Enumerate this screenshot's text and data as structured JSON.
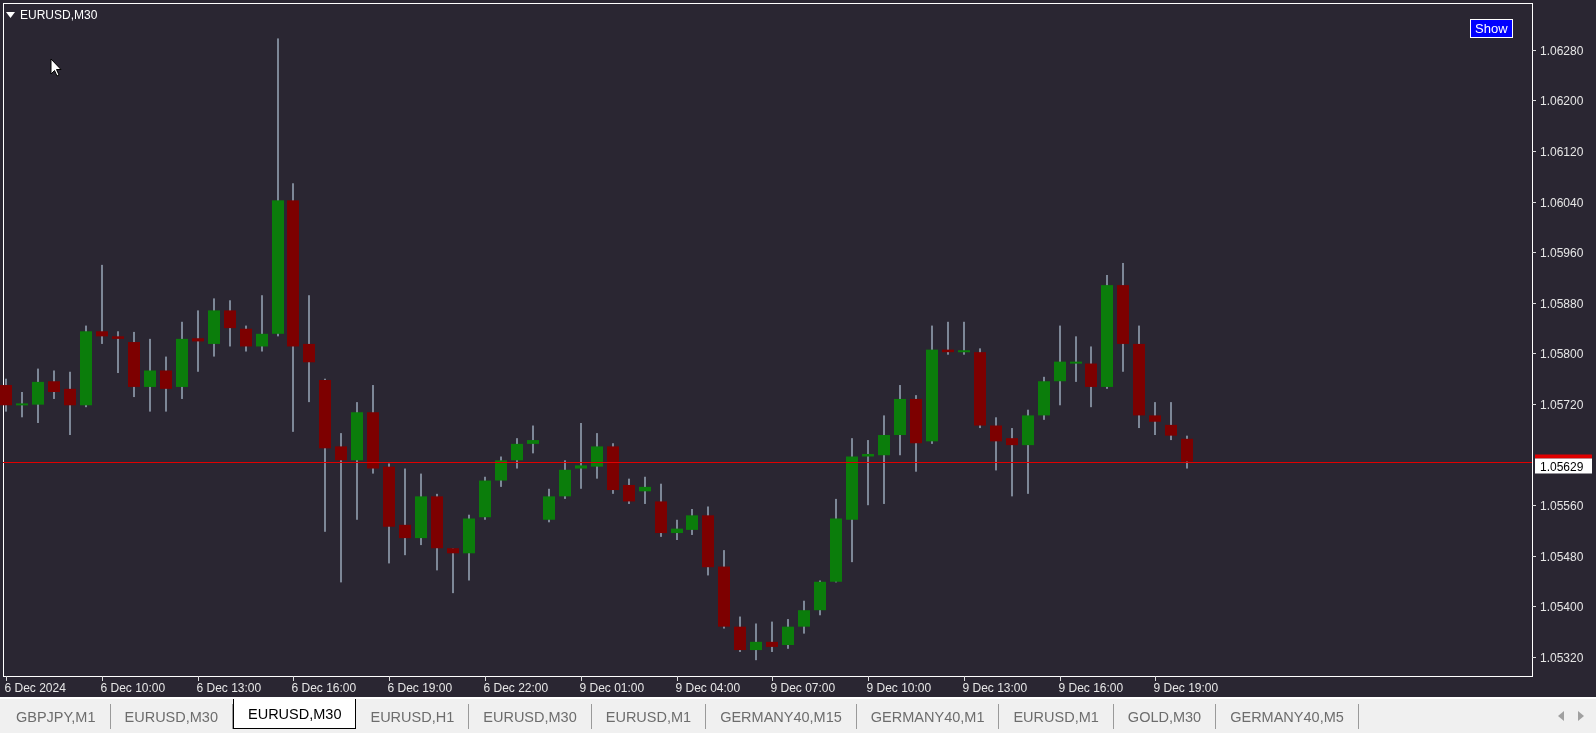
{
  "chart": {
    "title": "EURUSD,M30",
    "show_button": "Show",
    "current_price": "1.05629",
    "price_axis": [
      "1.06280",
      "1.06200",
      "1.06120",
      "1.06040",
      "1.05960",
      "1.05880",
      "1.05800",
      "1.05720",
      "1.05560",
      "1.05480",
      "1.05400",
      "1.05320"
    ],
    "time_axis": [
      "6 Dec 2024",
      "6 Dec 10:00",
      "6 Dec 13:00",
      "6 Dec 16:00",
      "6 Dec 19:00",
      "6 Dec 22:00",
      "9 Dec 01:00",
      "9 Dec 04:00",
      "9 Dec 07:00",
      "9 Dec 10:00",
      "9 Dec 13:00",
      "9 Dec 16:00",
      "9 Dec 19:00"
    ]
  },
  "tabs": [
    {
      "label": "GBPJPY,M1",
      "selected": false
    },
    {
      "label": "EURUSD,M30",
      "selected": false
    },
    {
      "label": "EURUSD,M30",
      "selected": true
    },
    {
      "label": "EURUSD,H1",
      "selected": false
    },
    {
      "label": "EURUSD,M30",
      "selected": false
    },
    {
      "label": "EURUSD,M1",
      "selected": false
    },
    {
      "label": "GERMANY40,M15",
      "selected": false
    },
    {
      "label": "GERMANY40,M1",
      "selected": false
    },
    {
      "label": "EURUSD,M1",
      "selected": false
    },
    {
      "label": "GOLD,M30",
      "selected": false
    },
    {
      "label": "GERMANY40,M5",
      "selected": false
    }
  ]
}
